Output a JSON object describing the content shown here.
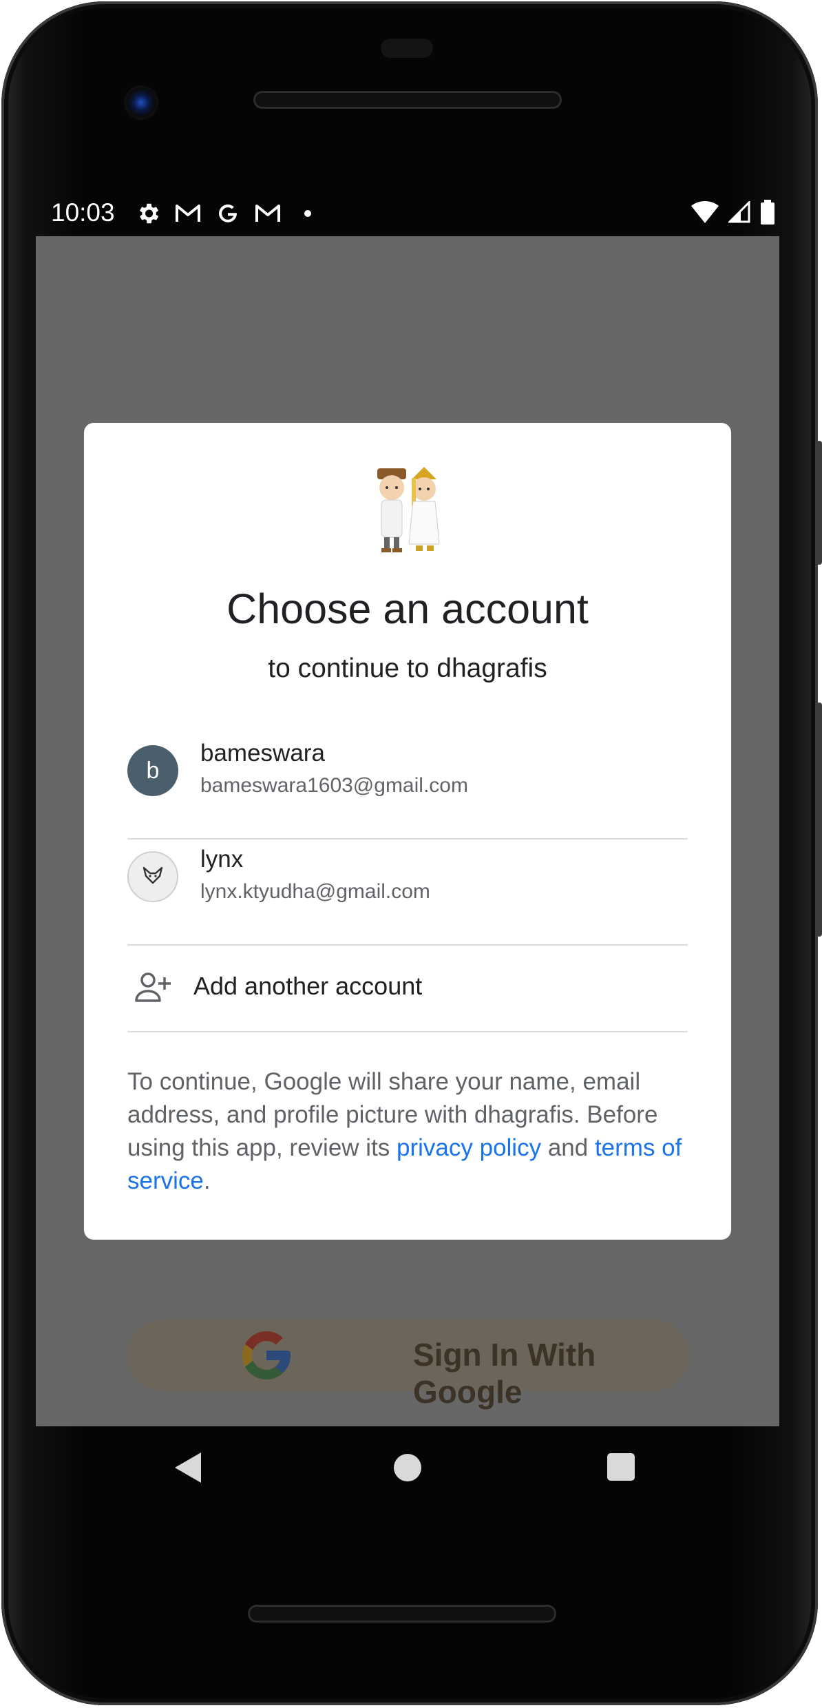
{
  "status_bar": {
    "time": "10:03",
    "left_icons": [
      "gear-icon",
      "gmail-icon",
      "google-g-icon",
      "gmail-icon",
      "notification-dot-icon"
    ],
    "right_icons": [
      "wifi-icon",
      "cell-signal-icon",
      "battery-icon"
    ]
  },
  "background_app": {
    "signin_button_label": "Sign In With Google",
    "signin_button_icon": "google-g-logo-icon"
  },
  "dialog": {
    "title": "Choose an account",
    "subtitle": "to continue to dhagrafis",
    "app_icon": "couple-mascot-icon",
    "accounts": [
      {
        "avatar_letter": "b",
        "avatar_color": "#4b5e6b",
        "name": "bameswara",
        "email": "bameswara1603@gmail.com"
      },
      {
        "avatar_icon": "fox-icon",
        "avatar_color": "#eeeeee",
        "name": "lynx",
        "email": "lynx.ktyudha@gmail.com"
      }
    ],
    "add_account": {
      "label": "Add another account",
      "icon": "person-add-icon"
    },
    "disclaimer": {
      "text_1": "To continue, Google will share your name, email address, and profile picture with dhagrafis. Before using this app, review its ",
      "privacy_link": "privacy policy",
      "text_2": " and ",
      "terms_link": "terms of service",
      "text_3": "."
    },
    "link_color": "#1a73e8"
  },
  "nav_bar": {
    "buttons": [
      "back-icon",
      "home-icon",
      "recents-icon"
    ]
  }
}
